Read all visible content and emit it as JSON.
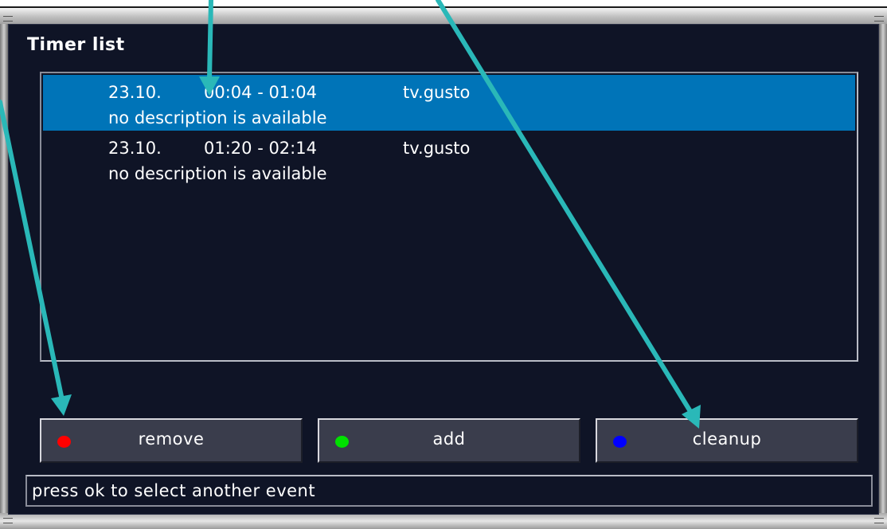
{
  "window": {
    "title": "Timer list"
  },
  "timer_list": {
    "rows": [
      {
        "date": "23.10.",
        "time": "00:04 - 01:04",
        "channel": "tv.gusto",
        "description": "no description is available",
        "selected": true
      },
      {
        "date": "23.10.",
        "time": "01:20 - 02:14",
        "channel": "tv.gusto",
        "description": "no description is available",
        "selected": false
      }
    ]
  },
  "buttons": {
    "red": {
      "label": "remove",
      "color": "#ff0000"
    },
    "green": {
      "label": "add",
      "color": "#00e000"
    },
    "blue": {
      "label": "cleanup",
      "color": "#0000ff"
    }
  },
  "status_bar": {
    "text": "press ok to select another event"
  },
  "colors": {
    "selection": "#0074b8",
    "background": "#0f1426",
    "annotation_arrow": "#2ab8b8"
  }
}
